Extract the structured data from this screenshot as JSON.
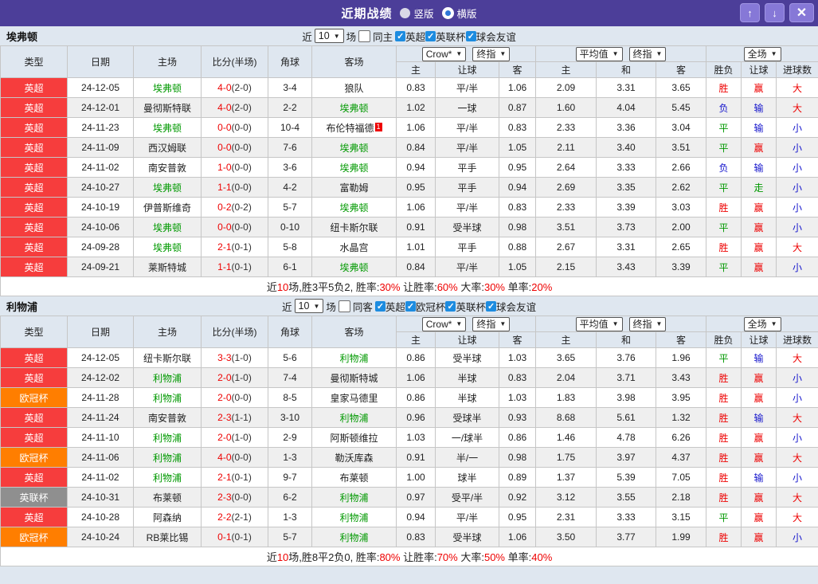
{
  "titlebar": {
    "title": "近期战绩",
    "view_options": [
      {
        "label": "竖版",
        "selected": false
      },
      {
        "label": "横版",
        "selected": true
      }
    ],
    "buttons": {
      "up": "↑",
      "down": "↓",
      "close": "✕"
    }
  },
  "colors": {
    "titlebar_bg": "#4c3e99",
    "titlebar_button_bg": "#8678d7",
    "epl_red": "#f63d3d",
    "ucl_orange": "#ff7e00",
    "efl_gray": "#8f8f8f",
    "team_green": "#009900",
    "score_red": "#ee0000",
    "lose_blue": "#1414cc",
    "handicap_col_bg": "#fdf8ec",
    "euro_col_bg": "#e9f4fb",
    "checkbox_blue": "#1d8ce0"
  },
  "table_headers": {
    "cols": [
      "类型",
      "日期",
      "主场",
      "比分(半场)",
      "角球",
      "客场"
    ],
    "handicap_selects": [
      "Crow*",
      "终指"
    ],
    "euro_selects": [
      "平均值",
      "终指"
    ],
    "result_select": "全场",
    "handicap_sub": [
      "主",
      "让球",
      "客"
    ],
    "euro_sub": [
      "主",
      "和",
      "客"
    ],
    "result_sub": [
      "胜负",
      "让球",
      "进球数"
    ]
  },
  "sections": [
    {
      "team": "埃弗顿",
      "filter": {
        "recent_label": "近",
        "count": "10",
        "unit_label": "场",
        "same_label": "同主",
        "same_checked": false,
        "leagues": [
          {
            "label": "英超",
            "checked": true
          },
          {
            "label": "英联杯",
            "checked": true
          },
          {
            "label": "球会友谊",
            "checked": true
          }
        ]
      },
      "rows": [
        {
          "league": "英超",
          "lg": "epl",
          "date": "24-12-05",
          "home": "埃弗顿",
          "home_team": true,
          "score": "4-0",
          "half": "(2-0)",
          "corner": "3-4",
          "away": "狼队",
          "away_team": false,
          "hh": "0.83",
          "hd": "平/半",
          "ha": "1.06",
          "eh": "2.09",
          "ed": "3.31",
          "ea": "3.65",
          "r1": {
            "t": "胜",
            "c": "r"
          },
          "r2": {
            "t": "赢",
            "c": "r"
          },
          "r3": {
            "t": "大",
            "c": "r"
          }
        },
        {
          "league": "英超",
          "lg": "epl",
          "date": "24-12-01",
          "home": "曼彻斯特联",
          "home_team": false,
          "score": "4-0",
          "half": "(2-0)",
          "corner": "2-2",
          "away": "埃弗顿",
          "away_team": true,
          "hh": "1.02",
          "hd": "一球",
          "ha": "0.87",
          "eh": "1.60",
          "ed": "4.04",
          "ea": "5.45",
          "r1": {
            "t": "负",
            "c": "b"
          },
          "r2": {
            "t": "输",
            "c": "b"
          },
          "r3": {
            "t": "大",
            "c": "r"
          }
        },
        {
          "league": "英超",
          "lg": "epl",
          "date": "24-11-23",
          "home": "埃弗顿",
          "home_team": true,
          "score": "0-0",
          "half": "(0-0)",
          "corner": "10-4",
          "away": "布伦特福德",
          "away_team": false,
          "badge": "1",
          "hh": "1.06",
          "hd": "平/半",
          "ha": "0.83",
          "eh": "2.33",
          "ed": "3.36",
          "ea": "3.04",
          "r1": {
            "t": "平",
            "c": "g"
          },
          "r2": {
            "t": "输",
            "c": "b"
          },
          "r3": {
            "t": "小",
            "c": "b"
          }
        },
        {
          "league": "英超",
          "lg": "epl",
          "date": "24-11-09",
          "home": "西汉姆联",
          "home_team": false,
          "score": "0-0",
          "half": "(0-0)",
          "corner": "7-6",
          "away": "埃弗顿",
          "away_team": true,
          "hh": "0.84",
          "hd": "平/半",
          "ha": "1.05",
          "eh": "2.11",
          "ed": "3.40",
          "ea": "3.51",
          "r1": {
            "t": "平",
            "c": "g"
          },
          "r2": {
            "t": "赢",
            "c": "r"
          },
          "r3": {
            "t": "小",
            "c": "b"
          }
        },
        {
          "league": "英超",
          "lg": "epl",
          "date": "24-11-02",
          "home": "南安普敦",
          "home_team": false,
          "score": "1-0",
          "half": "(0-0)",
          "corner": "3-6",
          "away": "埃弗顿",
          "away_team": true,
          "hh": "0.94",
          "hd": "平手",
          "ha": "0.95",
          "eh": "2.64",
          "ed": "3.33",
          "ea": "2.66",
          "r1": {
            "t": "负",
            "c": "b"
          },
          "r2": {
            "t": "输",
            "c": "b"
          },
          "r3": {
            "t": "小",
            "c": "b"
          }
        },
        {
          "league": "英超",
          "lg": "epl",
          "date": "24-10-27",
          "home": "埃弗顿",
          "home_team": true,
          "score": "1-1",
          "half": "(0-0)",
          "corner": "4-2",
          "away": "富勒姆",
          "away_team": false,
          "hh": "0.95",
          "hd": "平手",
          "ha": "0.94",
          "eh": "2.69",
          "ed": "3.35",
          "ea": "2.62",
          "r1": {
            "t": "平",
            "c": "g"
          },
          "r2": {
            "t": "走",
            "c": "g"
          },
          "r3": {
            "t": "小",
            "c": "b"
          }
        },
        {
          "league": "英超",
          "lg": "epl",
          "date": "24-10-19",
          "home": "伊普斯维奇",
          "home_team": false,
          "score": "0-2",
          "half": "(0-2)",
          "corner": "5-7",
          "away": "埃弗顿",
          "away_team": true,
          "hh": "1.06",
          "hd": "平/半",
          "ha": "0.83",
          "eh": "2.33",
          "ed": "3.39",
          "ea": "3.03",
          "r1": {
            "t": "胜",
            "c": "r"
          },
          "r2": {
            "t": "赢",
            "c": "r"
          },
          "r3": {
            "t": "小",
            "c": "b"
          }
        },
        {
          "league": "英超",
          "lg": "epl",
          "date": "24-10-06",
          "home": "埃弗顿",
          "home_team": true,
          "score": "0-0",
          "half": "(0-0)",
          "corner": "0-10",
          "away": "纽卡斯尔联",
          "away_team": false,
          "hh": "0.91",
          "hd": "受半球",
          "ha": "0.98",
          "eh": "3.51",
          "ed": "3.73",
          "ea": "2.00",
          "r1": {
            "t": "平",
            "c": "g"
          },
          "r2": {
            "t": "赢",
            "c": "r"
          },
          "r3": {
            "t": "小",
            "c": "b"
          }
        },
        {
          "league": "英超",
          "lg": "epl",
          "date": "24-09-28",
          "home": "埃弗顿",
          "home_team": true,
          "score": "2-1",
          "half": "(0-1)",
          "corner": "5-8",
          "away": "水晶宫",
          "away_team": false,
          "hh": "1.01",
          "hd": "平手",
          "ha": "0.88",
          "eh": "2.67",
          "ed": "3.31",
          "ea": "2.65",
          "r1": {
            "t": "胜",
            "c": "r"
          },
          "r2": {
            "t": "赢",
            "c": "r"
          },
          "r3": {
            "t": "大",
            "c": "r"
          }
        },
        {
          "league": "英超",
          "lg": "epl",
          "date": "24-09-21",
          "home": "莱斯特城",
          "home_team": false,
          "score": "1-1",
          "half": "(0-1)",
          "corner": "6-1",
          "away": "埃弗顿",
          "away_team": true,
          "hh": "0.84",
          "hd": "平/半",
          "ha": "1.05",
          "eh": "2.15",
          "ed": "3.43",
          "ea": "3.39",
          "r1": {
            "t": "平",
            "c": "g"
          },
          "r2": {
            "t": "赢",
            "c": "r"
          },
          "r3": {
            "t": "小",
            "c": "b"
          }
        }
      ],
      "summary": [
        {
          "t": "近"
        },
        {
          "t": "10",
          "c": "r"
        },
        {
          "t": "场,胜3平5负2, 胜率:"
        },
        {
          "t": "30%",
          "c": "r"
        },
        {
          "t": " 让胜率:"
        },
        {
          "t": "60%",
          "c": "r"
        },
        {
          "t": " 大率:"
        },
        {
          "t": "30%",
          "c": "r"
        },
        {
          "t": " 单率:"
        },
        {
          "t": "20%",
          "c": "r"
        }
      ]
    },
    {
      "team": "利物浦",
      "filter": {
        "recent_label": "近",
        "count": "10",
        "unit_label": "场",
        "same_label": "同客",
        "same_checked": false,
        "leagues": [
          {
            "label": "英超",
            "checked": true
          },
          {
            "label": "欧冠杯",
            "checked": true
          },
          {
            "label": "英联杯",
            "checked": true
          },
          {
            "label": "球会友谊",
            "checked": true
          }
        ]
      },
      "rows": [
        {
          "league": "英超",
          "lg": "epl",
          "date": "24-12-05",
          "home": "纽卡斯尔联",
          "home_team": false,
          "score": "3-3",
          "half": "(1-0)",
          "corner": "5-6",
          "away": "利物浦",
          "away_team": true,
          "hh": "0.86",
          "hd": "受半球",
          "ha": "1.03",
          "eh": "3.65",
          "ed": "3.76",
          "ea": "1.96",
          "r1": {
            "t": "平",
            "c": "g"
          },
          "r2": {
            "t": "输",
            "c": "b"
          },
          "r3": {
            "t": "大",
            "c": "r"
          }
        },
        {
          "league": "英超",
          "lg": "epl",
          "date": "24-12-02",
          "home": "利物浦",
          "home_team": true,
          "score": "2-0",
          "half": "(1-0)",
          "corner": "7-4",
          "away": "曼彻斯特城",
          "away_team": false,
          "hh": "1.06",
          "hd": "半球",
          "ha": "0.83",
          "eh": "2.04",
          "ed": "3.71",
          "ea": "3.43",
          "r1": {
            "t": "胜",
            "c": "r"
          },
          "r2": {
            "t": "赢",
            "c": "r"
          },
          "r3": {
            "t": "小",
            "c": "b"
          }
        },
        {
          "league": "欧冠杯",
          "lg": "ucl",
          "date": "24-11-28",
          "home": "利物浦",
          "home_team": true,
          "score": "2-0",
          "half": "(0-0)",
          "corner": "8-5",
          "away": "皇家马德里",
          "away_team": false,
          "hh": "0.86",
          "hd": "半球",
          "ha": "1.03",
          "eh": "1.83",
          "ed": "3.98",
          "ea": "3.95",
          "r1": {
            "t": "胜",
            "c": "r"
          },
          "r2": {
            "t": "赢",
            "c": "r"
          },
          "r3": {
            "t": "小",
            "c": "b"
          }
        },
        {
          "league": "英超",
          "lg": "epl",
          "date": "24-11-24",
          "home": "南安普敦",
          "home_team": false,
          "score": "2-3",
          "half": "(1-1)",
          "corner": "3-10",
          "away": "利物浦",
          "away_team": true,
          "hh": "0.96",
          "hd": "受球半",
          "ha": "0.93",
          "eh": "8.68",
          "ed": "5.61",
          "ea": "1.32",
          "r1": {
            "t": "胜",
            "c": "r"
          },
          "r2": {
            "t": "输",
            "c": "b"
          },
          "r3": {
            "t": "大",
            "c": "r"
          }
        },
        {
          "league": "英超",
          "lg": "epl",
          "date": "24-11-10",
          "home": "利物浦",
          "home_team": true,
          "score": "2-0",
          "half": "(1-0)",
          "corner": "2-9",
          "away": "阿斯顿维拉",
          "away_team": false,
          "hh": "1.03",
          "hd": "一/球半",
          "ha": "0.86",
          "eh": "1.46",
          "ed": "4.78",
          "ea": "6.26",
          "r1": {
            "t": "胜",
            "c": "r"
          },
          "r2": {
            "t": "赢",
            "c": "r"
          },
          "r3": {
            "t": "小",
            "c": "b"
          }
        },
        {
          "league": "欧冠杯",
          "lg": "ucl",
          "date": "24-11-06",
          "home": "利物浦",
          "home_team": true,
          "score": "4-0",
          "half": "(0-0)",
          "corner": "1-3",
          "away": "勒沃库森",
          "away_team": false,
          "hh": "0.91",
          "hd": "半/一",
          "ha": "0.98",
          "eh": "1.75",
          "ed": "3.97",
          "ea": "4.37",
          "r1": {
            "t": "胜",
            "c": "r"
          },
          "r2": {
            "t": "赢",
            "c": "r"
          },
          "r3": {
            "t": "大",
            "c": "r"
          }
        },
        {
          "league": "英超",
          "lg": "epl",
          "date": "24-11-02",
          "home": "利物浦",
          "home_team": true,
          "score": "2-1",
          "half": "(0-1)",
          "corner": "9-7",
          "away": "布莱顿",
          "away_team": false,
          "hh": "1.00",
          "hd": "球半",
          "ha": "0.89",
          "eh": "1.37",
          "ed": "5.39",
          "ea": "7.05",
          "r1": {
            "t": "胜",
            "c": "r"
          },
          "r2": {
            "t": "输",
            "c": "b"
          },
          "r3": {
            "t": "小",
            "c": "b"
          }
        },
        {
          "league": "英联杯",
          "lg": "efl",
          "date": "24-10-31",
          "home": "布莱顿",
          "home_team": false,
          "score": "2-3",
          "half": "(0-0)",
          "corner": "6-2",
          "away": "利物浦",
          "away_team": true,
          "hh": "0.97",
          "hd": "受平/半",
          "ha": "0.92",
          "eh": "3.12",
          "ed": "3.55",
          "ea": "2.18",
          "r1": {
            "t": "胜",
            "c": "r"
          },
          "r2": {
            "t": "赢",
            "c": "r"
          },
          "r3": {
            "t": "大",
            "c": "r"
          }
        },
        {
          "league": "英超",
          "lg": "epl",
          "date": "24-10-28",
          "home": "阿森纳",
          "home_team": false,
          "score": "2-2",
          "half": "(2-1)",
          "corner": "1-3",
          "away": "利物浦",
          "away_team": true,
          "hh": "0.94",
          "hd": "平/半",
          "ha": "0.95",
          "eh": "2.31",
          "ed": "3.33",
          "ea": "3.15",
          "r1": {
            "t": "平",
            "c": "g"
          },
          "r2": {
            "t": "赢",
            "c": "r"
          },
          "r3": {
            "t": "大",
            "c": "r"
          }
        },
        {
          "league": "欧冠杯",
          "lg": "ucl",
          "date": "24-10-24",
          "home": "RB莱比锡",
          "home_team": false,
          "score": "0-1",
          "half": "(0-1)",
          "corner": "5-7",
          "away": "利物浦",
          "away_team": true,
          "hh": "0.83",
          "hd": "受半球",
          "ha": "1.06",
          "eh": "3.50",
          "ed": "3.77",
          "ea": "1.99",
          "r1": {
            "t": "胜",
            "c": "r"
          },
          "r2": {
            "t": "赢",
            "c": "r"
          },
          "r3": {
            "t": "小",
            "c": "b"
          }
        }
      ],
      "summary": [
        {
          "t": "近"
        },
        {
          "t": "10",
          "c": "r"
        },
        {
          "t": "场,胜8平2负0, 胜率:"
        },
        {
          "t": "80%",
          "c": "r"
        },
        {
          "t": " 让胜率:"
        },
        {
          "t": "70%",
          "c": "r"
        },
        {
          "t": " 大率:"
        },
        {
          "t": "50%",
          "c": "r"
        },
        {
          "t": " 单率:"
        },
        {
          "t": "40%",
          "c": "r"
        }
      ]
    }
  ]
}
